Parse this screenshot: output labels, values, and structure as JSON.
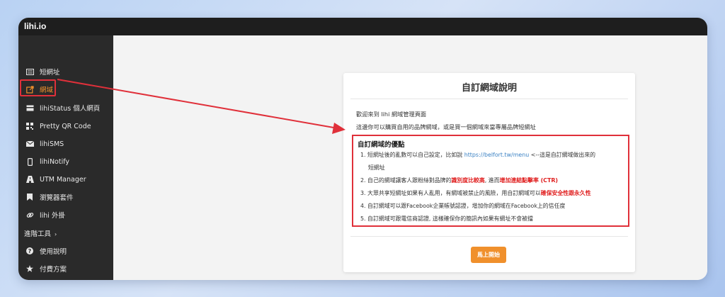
{
  "app": {
    "brand": "lihi.io"
  },
  "sidebar": {
    "items": [
      {
        "label": "短網址",
        "icon": "list-icon"
      },
      {
        "label": "網域",
        "icon": "external-link-icon",
        "active": true
      },
      {
        "label": "lihiStatus 個人網頁",
        "icon": "card-icon"
      },
      {
        "label": "Pretty QR Code",
        "icon": "qr-code-icon"
      },
      {
        "label": "lihiSMS",
        "icon": "envelope-icon"
      },
      {
        "label": "lihiNotify",
        "icon": "mobile-icon"
      },
      {
        "label": "UTM Manager",
        "icon": "road-icon"
      },
      {
        "label": "瀏覽器套件",
        "icon": "bookmark-icon"
      },
      {
        "label": "lihi 外掛",
        "icon": "link-icon"
      }
    ],
    "advanced_label": "進階工具",
    "advanced_chevron": "›",
    "bottom_items": [
      {
        "label": "使用說明",
        "icon": "question-icon"
      },
      {
        "label": "付費方案",
        "icon": "star-icon"
      }
    ]
  },
  "card": {
    "title": "自訂網域說明",
    "intro_line1": "歡迎來到 lihi 網域管理頁面",
    "intro_line2": "這邊你可以購買自用的品牌網域，或是買一個網域來當專屬品牌短網址",
    "advantages_title": "自訂網域的優點",
    "advantages": [
      {
        "num": "1.",
        "text_a": "短網址後的亂數可以自己設定，比如說 ",
        "link": "https://belfort.tw/menu",
        "text_b": " <--這是自訂網域做出來的",
        "text_c": "短網址"
      },
      {
        "num": "2.",
        "text_a": "自己的網域讓客人跟粉絲對品牌的",
        "red_a": "識別度比較高",
        "text_b": ", 進而",
        "red_b": "增加連結點擊率 (CTR)"
      },
      {
        "num": "3.",
        "text_a": "大眾共享短網址如果有人亂用，有網域被禁止的風險，用自訂網域可以",
        "red_a": "確保安全性跟永久性"
      },
      {
        "num": "4.",
        "text_a": "自訂網域可以跟Facebook企業帳號認證，增加你的網域在Facebook上的信任度"
      },
      {
        "num": "5.",
        "text_a": "自訂網域可跟電信商認證, 這樣確保你的簡訊內如果有網址不會被擋"
      }
    ],
    "start_button": "馬上開始"
  },
  "colors": {
    "accent": "#f0902c",
    "highlight": "#e0303a",
    "link": "#3b82c4",
    "sidebar_bg": "#2a2a2a"
  }
}
